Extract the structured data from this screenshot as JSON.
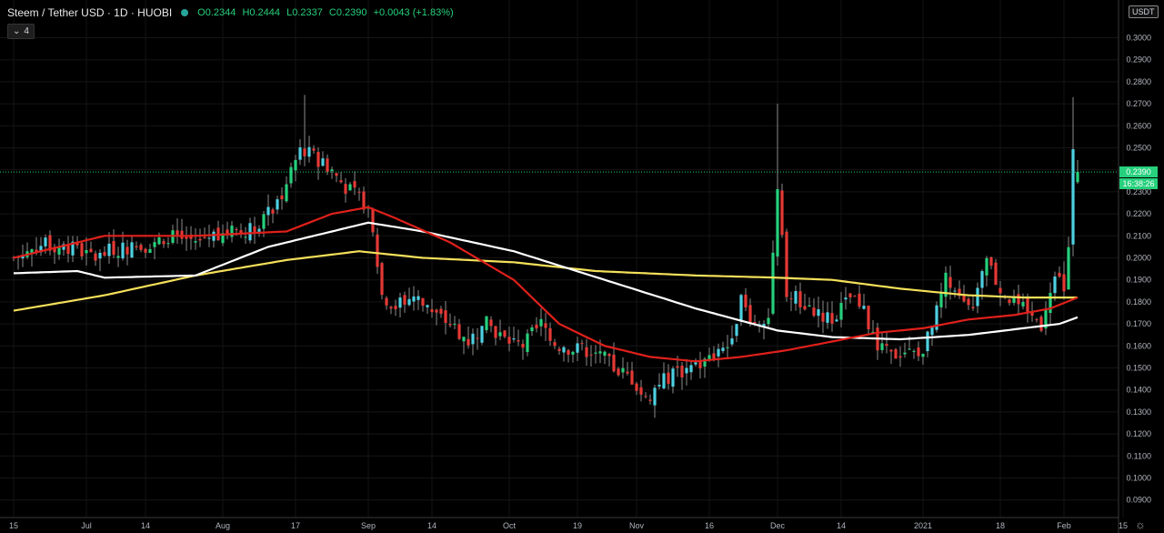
{
  "header": {
    "symbol": "Steem / Tether USD · 1D · HUOBI",
    "open": "O0.2344",
    "high": "H0.2444",
    "low": "L0.2337",
    "close": "C0.2390",
    "change": "+0.0043 (+1.83%)"
  },
  "indicators_button": {
    "label": "4"
  },
  "price_axis": {
    "unit": "USDT"
  },
  "last_price": {
    "value": "0.2390",
    "countdown": "16:38:26"
  },
  "colors": {
    "up": "#26d07c",
    "down": "#e53935",
    "candle_up_alt": "#4dd0e1",
    "ma_red": "#e0201b",
    "ma_white": "#ffffff",
    "ma_yellow": "#f5e05a",
    "background": "#000000",
    "grid": "#151515"
  },
  "chart_data": {
    "type": "candlestick",
    "y_ticks": [
      "0.3000",
      "0.2900",
      "0.2800",
      "0.2700",
      "0.2600",
      "0.2500",
      "0.2400",
      "0.2300",
      "0.2200",
      "0.2100",
      "0.2000",
      "0.1900",
      "0.1800",
      "0.1700",
      "0.1600",
      "0.1500",
      "0.1400",
      "0.1300",
      "0.1200",
      "0.1100",
      "0.1000",
      "0.0900"
    ],
    "ylim": [
      0.085,
      0.305
    ],
    "x_ticks": [
      "15",
      "Jul",
      "14",
      "Aug",
      "17",
      "Sep",
      "14",
      "Oct",
      "19",
      "Nov",
      "16",
      "Dec",
      "14",
      "2021",
      "18",
      "Feb",
      "15"
    ],
    "x_tick_days": [
      0,
      16,
      29,
      46,
      62,
      78,
      92,
      109,
      124,
      137,
      153,
      168,
      182,
      200,
      217,
      231,
      244
    ],
    "x_start_date": "2020-06-15",
    "last_day": 234,
    "close_anchors": [
      [
        0,
        0.2
      ],
      [
        6,
        0.206
      ],
      [
        12,
        0.205
      ],
      [
        18,
        0.2
      ],
      [
        22,
        0.204
      ],
      [
        28,
        0.205
      ],
      [
        34,
        0.21
      ],
      [
        40,
        0.208
      ],
      [
        46,
        0.212
      ],
      [
        52,
        0.213
      ],
      [
        56,
        0.22
      ],
      [
        60,
        0.232
      ],
      [
        63,
        0.25
      ],
      [
        66,
        0.246
      ],
      [
        70,
        0.24
      ],
      [
        73,
        0.232
      ],
      [
        77,
        0.225
      ],
      [
        79,
        0.215
      ],
      [
        81,
        0.183
      ],
      [
        84,
        0.178
      ],
      [
        88,
        0.183
      ],
      [
        92,
        0.175
      ],
      [
        96,
        0.17
      ],
      [
        100,
        0.162
      ],
      [
        104,
        0.17
      ],
      [
        108,
        0.163
      ],
      [
        112,
        0.16
      ],
      [
        116,
        0.17
      ],
      [
        120,
        0.16
      ],
      [
        124,
        0.158
      ],
      [
        128,
        0.158
      ],
      [
        132,
        0.15
      ],
      [
        136,
        0.145
      ],
      [
        139,
        0.135
      ],
      [
        142,
        0.143
      ],
      [
        146,
        0.148
      ],
      [
        150,
        0.15
      ],
      [
        154,
        0.155
      ],
      [
        157,
        0.16
      ],
      [
        160,
        0.18
      ],
      [
        163,
        0.17
      ],
      [
        166,
        0.175
      ],
      [
        168,
        0.23
      ],
      [
        170,
        0.185
      ],
      [
        173,
        0.18
      ],
      [
        177,
        0.175
      ],
      [
        180,
        0.172
      ],
      [
        184,
        0.182
      ],
      [
        187,
        0.175
      ],
      [
        190,
        0.16
      ],
      [
        193,
        0.155
      ],
      [
        196,
        0.158
      ],
      [
        199,
        0.155
      ],
      [
        202,
        0.168
      ],
      [
        205,
        0.19
      ],
      [
        208,
        0.18
      ],
      [
        211,
        0.175
      ],
      [
        214,
        0.2
      ],
      [
        217,
        0.185
      ],
      [
        220,
        0.18
      ],
      [
        223,
        0.175
      ],
      [
        226,
        0.17
      ],
      [
        229,
        0.195
      ],
      [
        231,
        0.185
      ],
      [
        232,
        0.205
      ],
      [
        233,
        0.25
      ],
      [
        234,
        0.239
      ]
    ],
    "ma_red_anchors": [
      [
        0,
        0.2
      ],
      [
        20,
        0.21
      ],
      [
        40,
        0.21
      ],
      [
        60,
        0.212
      ],
      [
        70,
        0.22
      ],
      [
        78,
        0.223
      ],
      [
        84,
        0.218
      ],
      [
        96,
        0.207
      ],
      [
        110,
        0.19
      ],
      [
        120,
        0.17
      ],
      [
        130,
        0.16
      ],
      [
        140,
        0.155
      ],
      [
        150,
        0.153
      ],
      [
        160,
        0.155
      ],
      [
        170,
        0.158
      ],
      [
        180,
        0.162
      ],
      [
        190,
        0.166
      ],
      [
        200,
        0.168
      ],
      [
        210,
        0.172
      ],
      [
        220,
        0.174
      ],
      [
        228,
        0.177
      ],
      [
        234,
        0.182
      ]
    ],
    "ma_white_anchors": [
      [
        0,
        0.193
      ],
      [
        14,
        0.194
      ],
      [
        20,
        0.191
      ],
      [
        40,
        0.192
      ],
      [
        56,
        0.205
      ],
      [
        70,
        0.212
      ],
      [
        78,
        0.216
      ],
      [
        90,
        0.212
      ],
      [
        110,
        0.203
      ],
      [
        130,
        0.19
      ],
      [
        150,
        0.177
      ],
      [
        168,
        0.167
      ],
      [
        180,
        0.164
      ],
      [
        195,
        0.163
      ],
      [
        210,
        0.165
      ],
      [
        222,
        0.168
      ],
      [
        230,
        0.17
      ],
      [
        234,
        0.173
      ]
    ],
    "ma_yellow_anchors": [
      [
        0,
        0.176
      ],
      [
        20,
        0.183
      ],
      [
        40,
        0.192
      ],
      [
        60,
        0.199
      ],
      [
        76,
        0.203
      ],
      [
        90,
        0.2
      ],
      [
        110,
        0.198
      ],
      [
        128,
        0.194
      ],
      [
        150,
        0.192
      ],
      [
        168,
        0.191
      ],
      [
        180,
        0.19
      ],
      [
        195,
        0.186
      ],
      [
        210,
        0.183
      ],
      [
        222,
        0.182
      ],
      [
        234,
        0.182
      ]
    ]
  }
}
